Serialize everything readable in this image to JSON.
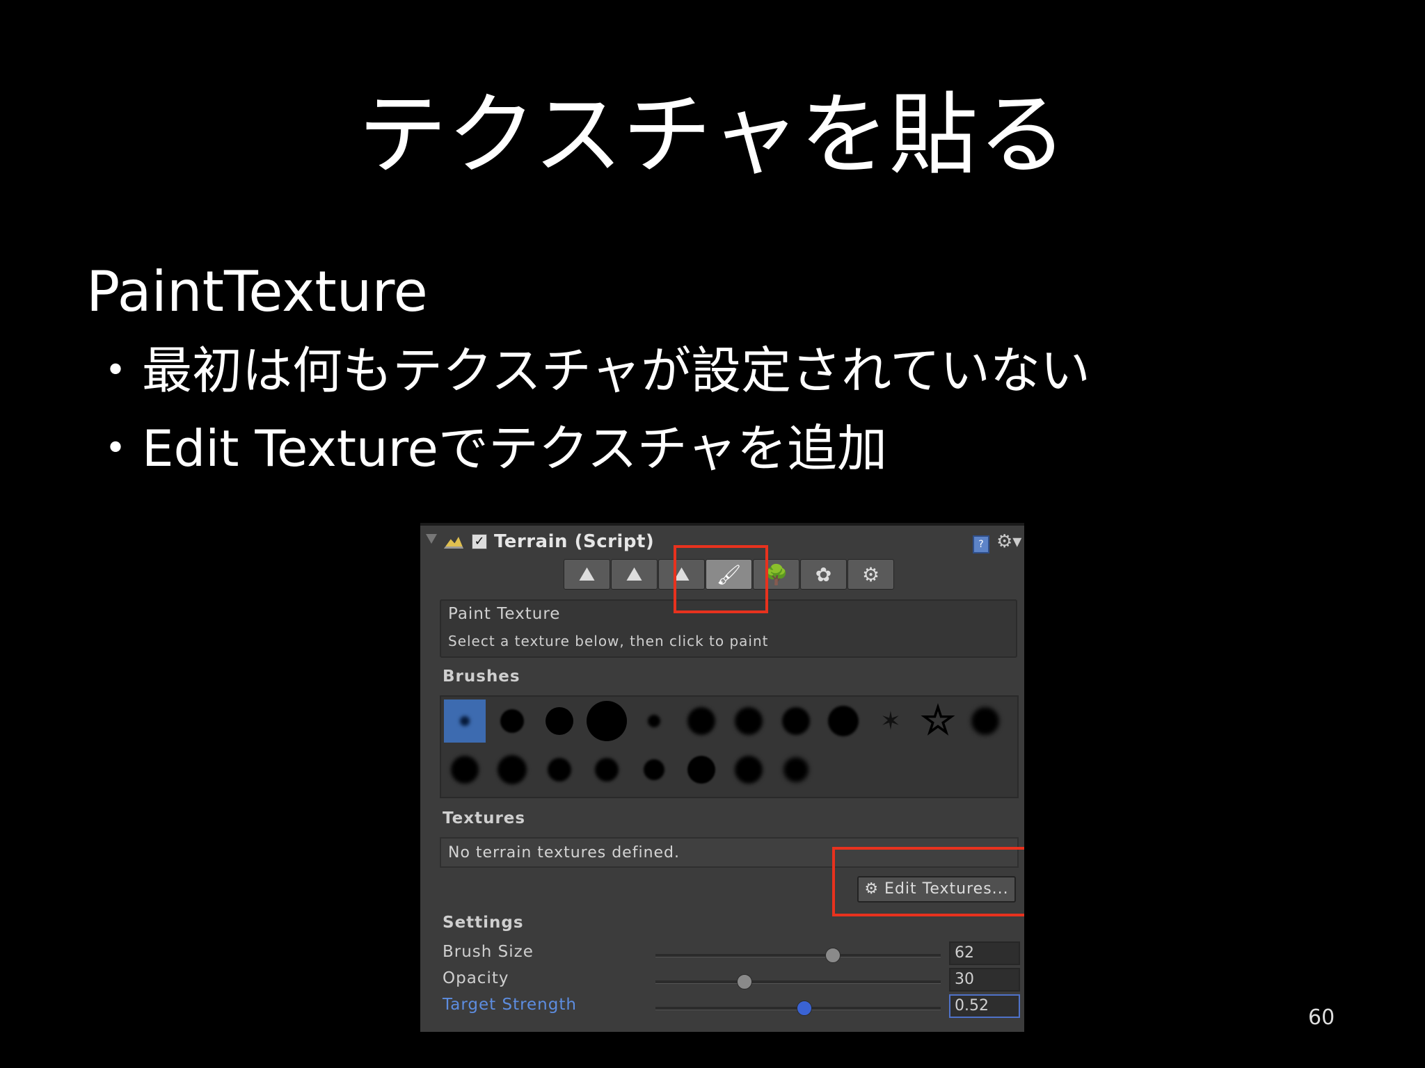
{
  "slide": {
    "title": "テクスチャを貼る",
    "heading": "PaintTexture",
    "bullets": [
      "最初は何もテクスチャが設定されていない",
      "Edit Textureでテクスチャを追加"
    ],
    "bullet_marker": "・",
    "page_number": "60"
  },
  "inspector": {
    "component_title": "Terrain (Script)",
    "enabled": true,
    "check_glyph": "✓",
    "help_glyph": "?",
    "cog_glyph": "⚙▾",
    "toolbar": {
      "tools": [
        {
          "icon": "raise-terrain-icon",
          "glyph": "⛰"
        },
        {
          "icon": "paint-height-icon",
          "glyph": "⛰"
        },
        {
          "icon": "smooth-height-icon",
          "glyph": "⛰"
        },
        {
          "icon": "paint-texture-icon",
          "glyph": "🖌"
        },
        {
          "icon": "place-trees-icon",
          "glyph": "🌳"
        },
        {
          "icon": "paint-details-icon",
          "glyph": "✿"
        },
        {
          "icon": "terrain-settings-icon",
          "glyph": "⚙"
        }
      ],
      "active_index": 3
    },
    "info": {
      "title": "Paint Texture",
      "hint": "Select a texture below, then click to paint"
    },
    "brushes_label": "Brushes",
    "brushes": {
      "selected_index": 0,
      "count": 20
    },
    "textures_label": "Textures",
    "textures_empty": "No terrain textures defined.",
    "edit_textures_button": "⚙ Edit Textures...",
    "settings_label": "Settings",
    "settings": [
      {
        "label": "Brush Size",
        "value": "62",
        "fraction": 0.62,
        "focused": false
      },
      {
        "label": "Opacity",
        "value": "30",
        "fraction": 0.31,
        "focused": false
      },
      {
        "label": "Target Strength",
        "value": "0.52",
        "fraction": 0.52,
        "focused": true
      }
    ]
  },
  "colors": {
    "highlight": "#e8321e",
    "selection_blue": "#3d6bb0",
    "focus_blue": "#5d8de0"
  }
}
